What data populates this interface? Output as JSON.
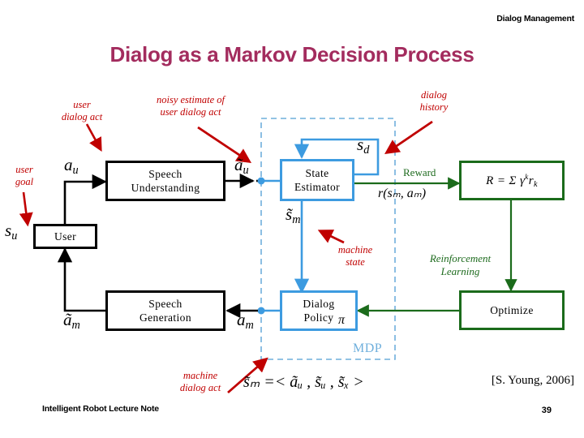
{
  "slide": {
    "header_right": "Dialog Management",
    "title": "Dialog as a Markov Decision Process",
    "footer_left": "Intelligent Robot Lecture Note",
    "page_number": "39",
    "citation": "[S. Young, 2006]"
  },
  "boxes": {
    "user": {
      "label": "User"
    },
    "speech_understanding": {
      "line1": "Speech",
      "line2": "Understanding"
    },
    "speech_generation": {
      "line1": "Speech",
      "line2": "Generation"
    },
    "state_estimator": {
      "line1": "State",
      "line2": "Estimator"
    },
    "dialog_policy": {
      "line1": "Dialog",
      "line2": "Policy",
      "symbol": "π"
    },
    "reward": {
      "formula": "R = Σ γ",
      "sup": "k",
      "sub": "k",
      "tail": "r",
      "tail_sub": "k"
    },
    "optimize": {
      "label": "Optimize"
    }
  },
  "annotations": {
    "user_goal": {
      "line1": "user",
      "line2": "goal"
    },
    "user_dialog_act": {
      "line1": "user",
      "line2": "dialog act"
    },
    "noisy_estimate": {
      "line1": "noisy estimate of",
      "line2": "user dialog act"
    },
    "dialog_history": {
      "line1": "dialog",
      "line2": "history"
    },
    "machine_state": {
      "line1": "machine",
      "line2": "state"
    },
    "machine_dialog_act": {
      "line1": "machine",
      "line2": "dialog act"
    },
    "reinforcement_learning": {
      "line1": "Reinforcement",
      "line2": "Learning"
    },
    "reward_label": "Reward",
    "mdp_label": "MDP"
  },
  "symbols": {
    "s_u": {
      "base": "s",
      "sub": "u"
    },
    "a_u": {
      "base": "a",
      "sub": "u"
    },
    "a_u_tilde": {
      "base": "ã",
      "sub": "u"
    },
    "s_d": {
      "base": "s",
      "sub": "d"
    },
    "s_m_tilde": {
      "base": "s̃",
      "sub": "m"
    },
    "a_m": {
      "base": "a",
      "sub": "m"
    },
    "a_m_tilde": {
      "base": "ã",
      "sub": "m"
    },
    "reward_function": "r(sₘ, aₘ)",
    "state_definition": "s̃ₘ =< ãᵤ , s̃ᵤ , s̃ₓ >"
  },
  "colors": {
    "title": "#A32C5E",
    "annotation_red": "#C00000",
    "blue": "#3D9BE0",
    "green": "#1B6B1B",
    "black": "#000000",
    "mdp_dashed": "#6FAFDC"
  }
}
